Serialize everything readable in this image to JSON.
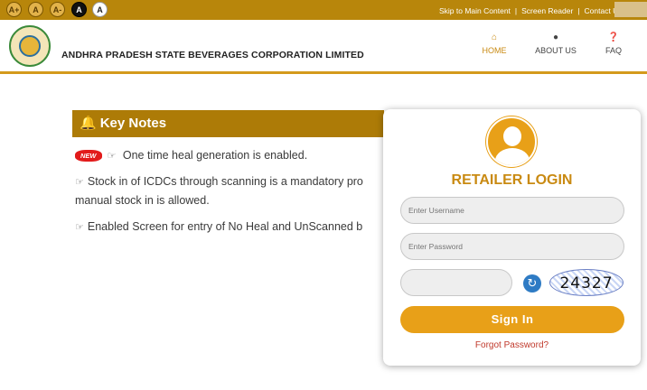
{
  "topbar": {
    "font_buttons": [
      "A+",
      "A",
      "A-",
      "A",
      "A"
    ],
    "links": [
      "Skip to Main Content",
      "Screen Reader",
      "Contact Us"
    ],
    "separator": "|"
  },
  "header": {
    "org_name": "ANDHRA PRADESH STATE BEVERAGES CORPORATION LIMITED",
    "nav": [
      {
        "label": "HOME",
        "icon": "home-icon"
      },
      {
        "label": "ABOUT US",
        "icon": "user-icon"
      },
      {
        "label": "FAQ",
        "icon": "question-icon"
      }
    ]
  },
  "key_notes": {
    "title": "Key Notes",
    "new_badge": "NEW",
    "items": [
      "One time heal generation is enabled.",
      "Stock in of ICDCs through scanning is a mandatory pro",
      "manual stock in is allowed.",
      "Enabled Screen for entry of No Heal and UnScanned b"
    ]
  },
  "login": {
    "title": "RETAILER LOGIN",
    "username_placeholder": "Enter Username",
    "password_placeholder": "Enter Password",
    "captcha_text": "24327",
    "signin_label": "Sign In",
    "forgot_label": "Forgot Password?"
  },
  "colors": {
    "topbar": "#b8860b",
    "accent": "#e8a018",
    "keynotes_header": "#ad7b07",
    "forgot_link": "#c0392b"
  }
}
